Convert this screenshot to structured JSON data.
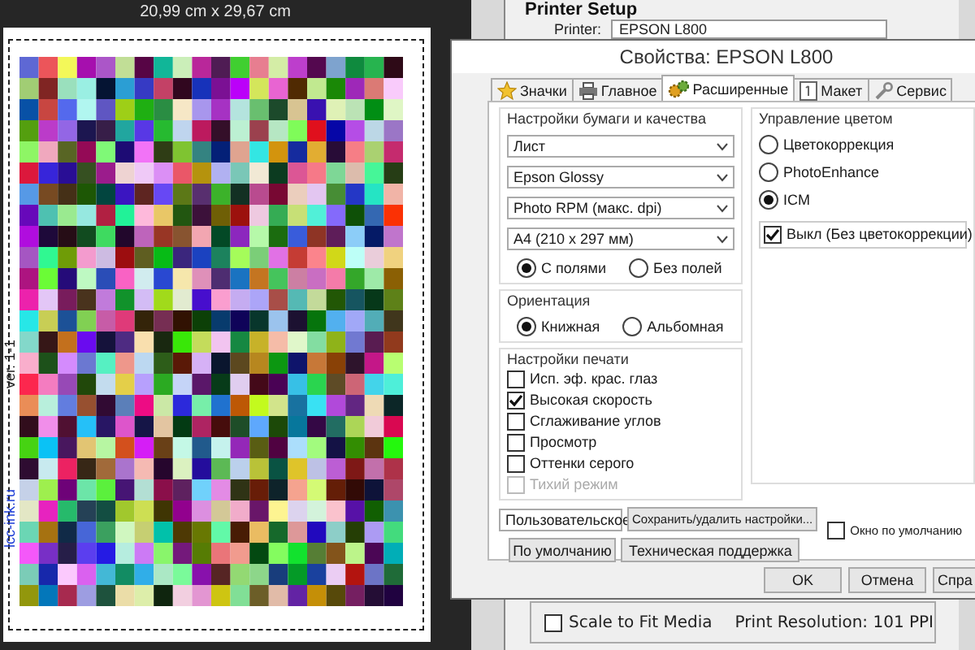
{
  "document": {
    "size": "20,99 cm x 29,67 cm",
    "side_labels": [
      {
        "text": "ver. 1-1",
        "kind": "version"
      },
      {
        "text": "lcc-ink.ru",
        "kind": "link"
      }
    ]
  },
  "printer_setup": {
    "title": "Printer Setup",
    "printer_label": "Printer:",
    "printer": "EPSON L800",
    "scale_to_fit": {
      "label": "Scale to Fit Media",
      "checked": false
    },
    "print_resolution": "Print Resolution: 101 PPI"
  },
  "dialog": {
    "title": "Свойства: EPSON L800",
    "tabs": [
      {
        "label": "Значки",
        "selected": false
      },
      {
        "label": "Главное",
        "selected": false
      },
      {
        "label": "Расширенные",
        "selected": true
      },
      {
        "label": "Макет",
        "selected": false
      },
      {
        "label": "Сервис",
        "selected": false
      }
    ],
    "paper_quality": {
      "title": "Настройки бумаги и качества",
      "dropdowns": [
        "Лист",
        "Epson Glossy",
        "Photo RPM (макс. dpi)",
        "A4 (210 x 297 мм)"
      ],
      "borders": [
        {
          "label": "С полями",
          "selected": true
        },
        {
          "label": "Без полей",
          "selected": false
        }
      ]
    },
    "orientation": {
      "title": "Ориентация",
      "options": [
        {
          "label": "Книжная",
          "selected": true
        },
        {
          "label": "Альбомная",
          "selected": false
        }
      ]
    },
    "print_settings": {
      "title": "Настройки печати",
      "options": [
        {
          "label": "Исп. эф. крас. глаз",
          "checked": false,
          "disabled": false
        },
        {
          "label": "Высокая скорость",
          "checked": true,
          "disabled": false
        },
        {
          "label": "Сглаживание углов",
          "checked": false,
          "disabled": false
        },
        {
          "label": "Просмотр",
          "checked": false,
          "disabled": false
        },
        {
          "label": "Оттенки серого",
          "checked": false,
          "disabled": false
        },
        {
          "label": "Тихий режим",
          "checked": false,
          "disabled": true
        }
      ]
    },
    "color_management": {
      "title": "Управление цветом",
      "options": [
        {
          "label": "Цветокоррекция",
          "selected": false
        },
        {
          "label": "PhotoEnhance",
          "selected": false
        },
        {
          "label": "ICM",
          "selected": true
        }
      ],
      "icm_off": {
        "label": "Выкл (Без цветокоррекции)",
        "checked": true
      }
    },
    "preset": "Пользовательское",
    "save_button": "Сохранить/удалить настройки...",
    "default_window": {
      "label": "Окно по умолчанию",
      "checked": false
    },
    "buttons": [
      "По умолчанию",
      "Техническая поддержка"
    ],
    "footer_buttons": [
      "OK",
      "Отмена",
      "Спра"
    ]
  }
}
